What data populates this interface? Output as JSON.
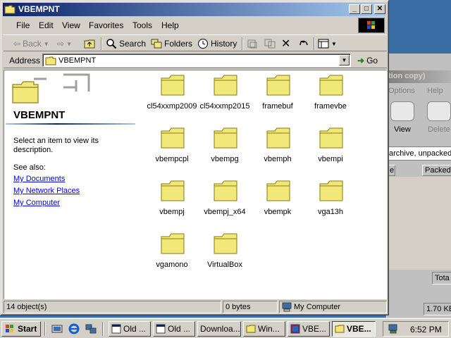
{
  "window": {
    "title": "VBEMPNT",
    "caption_minimize": "_",
    "caption_maximize": "□",
    "caption_close": "✕"
  },
  "menu": {
    "items": [
      "File",
      "Edit",
      "View",
      "Favorites",
      "Tools",
      "Help"
    ]
  },
  "toolbar": {
    "back_label": "Back",
    "forward_glyph": "⇨",
    "search_label": "Search",
    "folders_label": "Folders",
    "history_label": "History"
  },
  "address": {
    "label": "Address",
    "value": "VBEMPNT",
    "go_label": "Go"
  },
  "left_pane": {
    "folder_title": "VBEMPNT",
    "description": "Select an item to view its description.",
    "see_also": "See also:",
    "links": [
      "My Documents",
      "My Network Places",
      "My Computer"
    ]
  },
  "files": [
    "cl54xxmp2009",
    "cl54xxmp2015",
    "framebuf",
    "framevbe",
    "vbempcpl",
    "vbempg",
    "vbemph",
    "vbempi",
    "vbempj",
    "vbempj_x64",
    "vbempk",
    "vga13h",
    "vgamono",
    "VirtualBox"
  ],
  "status": {
    "objects": "14 object(s)",
    "size": "0 bytes",
    "zone": "My Computer"
  },
  "background_window": {
    "title": "tion copy)",
    "menu": [
      "Options",
      "Help"
    ],
    "tools": [
      "View",
      "Delete"
    ],
    "archive_text": "archive, unpacked",
    "col_left": "e",
    "col_packed": "Packed",
    "status_total": "Tota",
    "status_size": "1.70 KB"
  },
  "taskbar": {
    "start_label": "Start",
    "buttons": [
      "Old ...",
      "Old ...",
      "Downloa...",
      "Win...",
      "VBE...",
      "VBE..."
    ],
    "clock": "6:52 PM"
  },
  "colors": {
    "title_active": "#0a246a",
    "folder_fill": "#f0e878",
    "link": "#0000ee"
  }
}
